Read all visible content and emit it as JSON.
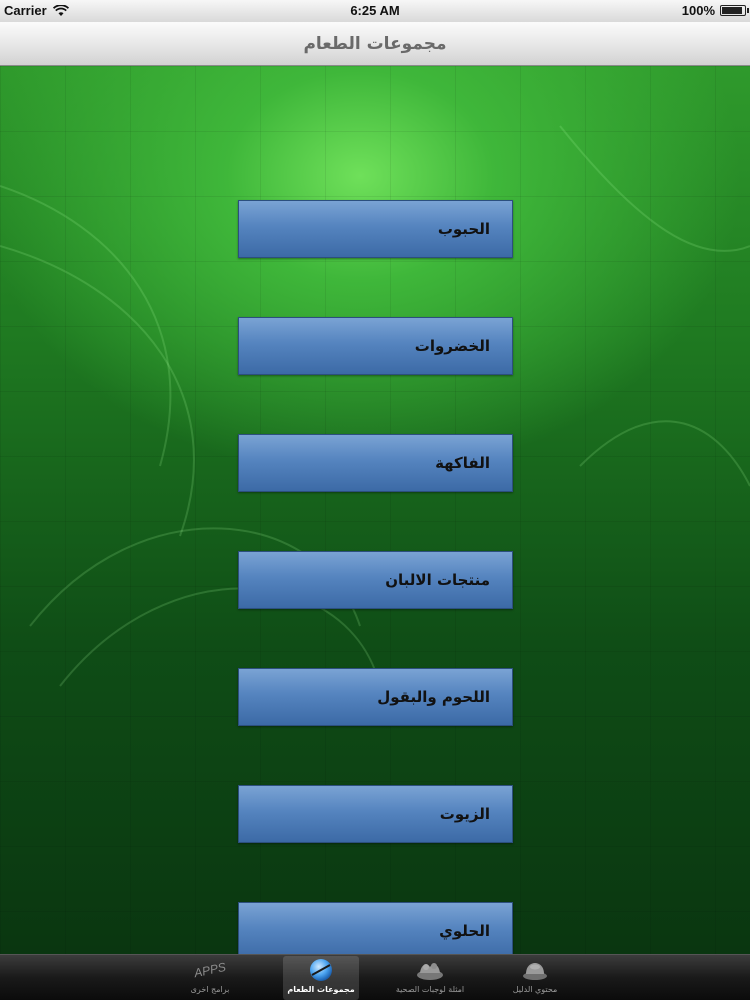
{
  "status_bar": {
    "carrier": "Carrier",
    "time": "6:25 AM",
    "battery": "100%"
  },
  "nav_bar": {
    "title": "مجموعات الطعام"
  },
  "categories": [
    {
      "label": "الحبوب"
    },
    {
      "label": "الخضروات"
    },
    {
      "label": "الفاكهة"
    },
    {
      "label": "منتجات الالبان"
    },
    {
      "label": "اللحوم والبقول"
    },
    {
      "label": "الزيوت"
    },
    {
      "label": "الحلوي"
    }
  ],
  "tab_bar": {
    "items": [
      {
        "label": "برامج اخرى",
        "icon": "apps-icon",
        "icon_text": "APPS",
        "selected": false
      },
      {
        "label": "مجموعات الطعام",
        "icon": "globe-icon",
        "selected": true
      },
      {
        "label": "امثلة لوجبات الصحية",
        "icon": "food-plate-icon",
        "selected": false
      },
      {
        "label": "محتوي الدليل",
        "icon": "contents-icon",
        "selected": false
      }
    ]
  },
  "colors": {
    "button_top": "#7aa3d4",
    "button_bottom": "#3c6aa6",
    "background_green": "#1f7a21"
  }
}
